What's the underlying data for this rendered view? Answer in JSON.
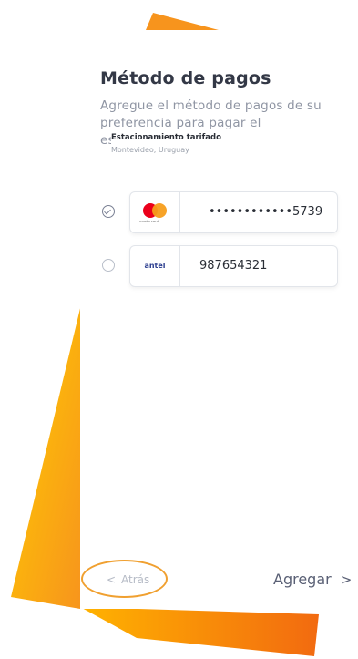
{
  "header": {
    "title": "Método de pagos",
    "subtitle": "Agregue el método de pagos de su preferencia para pagar el estacionamiento, y e"
  },
  "tooltip": {
    "title": "Estacionamiento tarifado",
    "location": "Montevideo, Uruguay"
  },
  "methods": [
    {
      "brand": "mastercard",
      "brand_text": "mastercard",
      "value": "••••••••••••5739",
      "selected": true
    },
    {
      "brand": "antel",
      "brand_text": "antel",
      "value": "987654321",
      "selected": false
    }
  ],
  "footer": {
    "back_label": "Atrás",
    "back_icon": "chevron-left-icon",
    "next_label": "Agregar",
    "next_icon": "chevron-right-icon"
  },
  "colors": {
    "accent_orange": "#f7941d",
    "accent_yellow": "#ffc400",
    "title": "#333846",
    "muted": "#8f95a3",
    "mastercard_red": "#eb001b",
    "mastercard_orange": "#f79e1b"
  }
}
